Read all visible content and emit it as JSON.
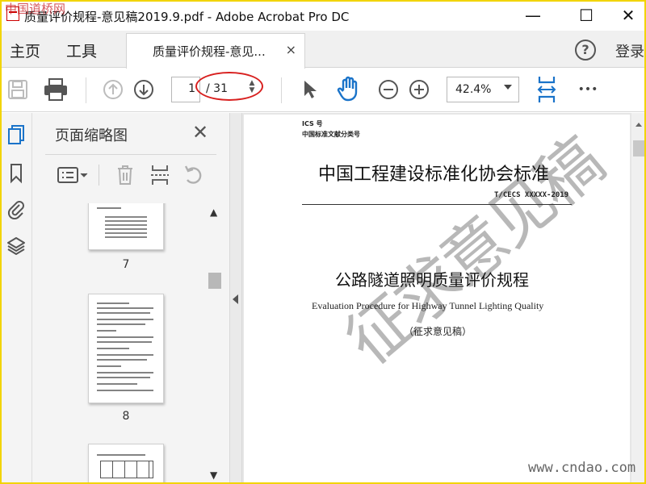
{
  "window": {
    "title": "质量评价规程-意见稿2019.9.pdf - Adobe Acrobat Pro DC",
    "minimize": "—",
    "maximize": "☐",
    "close": "✕"
  },
  "menu": {
    "home": "主页",
    "tools": "工具"
  },
  "tab": {
    "label": "质量评价规程-意见...",
    "close": "×"
  },
  "header_right": {
    "help": "?",
    "login": "登录"
  },
  "toolbar": {
    "page_current": "1",
    "page_total": "/ 31",
    "zoom": "42.4%",
    "more": "•••"
  },
  "panel": {
    "title": "页面缩略图",
    "close": "✕",
    "thumbnails": [
      {
        "label": "7"
      },
      {
        "label": "8"
      }
    ]
  },
  "document": {
    "ics": "ICS 号",
    "class_no": "中国标准文献分类号",
    "org_title": "中国工程建设标准化协会标准",
    "code": "T/CECS XXXXX-2019",
    "main_title": "公路隧道照明质量评价规程",
    "english_title": "Evaluation Procedure for Highway Tunnel Lighting Quality",
    "draft": "（征求意见稿）",
    "watermark": "征求意见稿"
  },
  "watermarks": {
    "top_left": "中国道桥网",
    "bottom_right": "www.cndao.com"
  },
  "colors": {
    "accent_blue": "#1a73c9",
    "highlight_red": "#d8201f",
    "frame_yellow": "#f2d400"
  }
}
